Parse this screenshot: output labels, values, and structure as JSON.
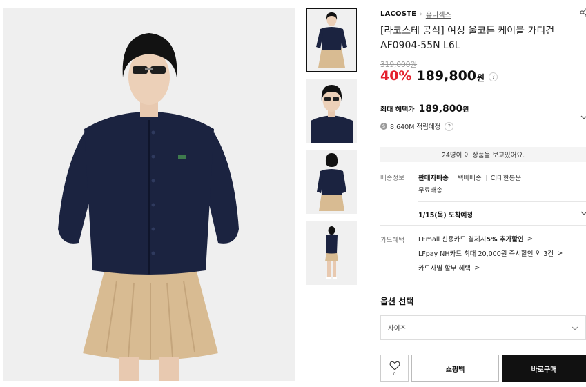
{
  "product": {
    "brand": "LACOSTE",
    "category": "유니섹스",
    "title": "[라코스테 공식] 여성 울코튼 케이블 가디건 AF0904-55N L6L",
    "original_price": "319,000원",
    "discount": "40%",
    "price": "189,800",
    "price_unit": "원",
    "help": "?"
  },
  "benefit": {
    "label": "최대 혜택가",
    "price": "189,800",
    "unit": "원",
    "coin": "$",
    "points": "8,640M 적립예정",
    "help": "?"
  },
  "viewers": "24명이 이 상품을 보고있어요.",
  "shipping": {
    "label": "배송정보",
    "options": [
      "판매자배송",
      "택배배송",
      "CJ대한통운"
    ],
    "free": "무료배송",
    "arrival": "1/15(목) 도착예정"
  },
  "card": {
    "label": "카드혜택",
    "lines": [
      {
        "prefix": "LFmall 신용카드 결제시 ",
        "bold": "5% 추가할인",
        "arrow": ">"
      },
      {
        "prefix": "LFpay NH카드 최대 20,000원 즉시할인 외 3건",
        "bold": "",
        "arrow": ">"
      },
      {
        "prefix": "카드사별 할부 혜택",
        "bold": "",
        "arrow": ">"
      }
    ]
  },
  "options": {
    "title": "옵션 선택",
    "size_label": "사이즈"
  },
  "actions": {
    "wish_count": "0",
    "cart": "쇼핑백",
    "buy": "바로구매"
  },
  "colors": {
    "accent_red": "#e4202d",
    "navy": "#1b2340",
    "beige": "#d8bb92",
    "buy_button": "#111111"
  },
  "icons": [
    "share-icon",
    "help-icon",
    "chevron-down-icon",
    "coin-icon",
    "heart-icon"
  ]
}
